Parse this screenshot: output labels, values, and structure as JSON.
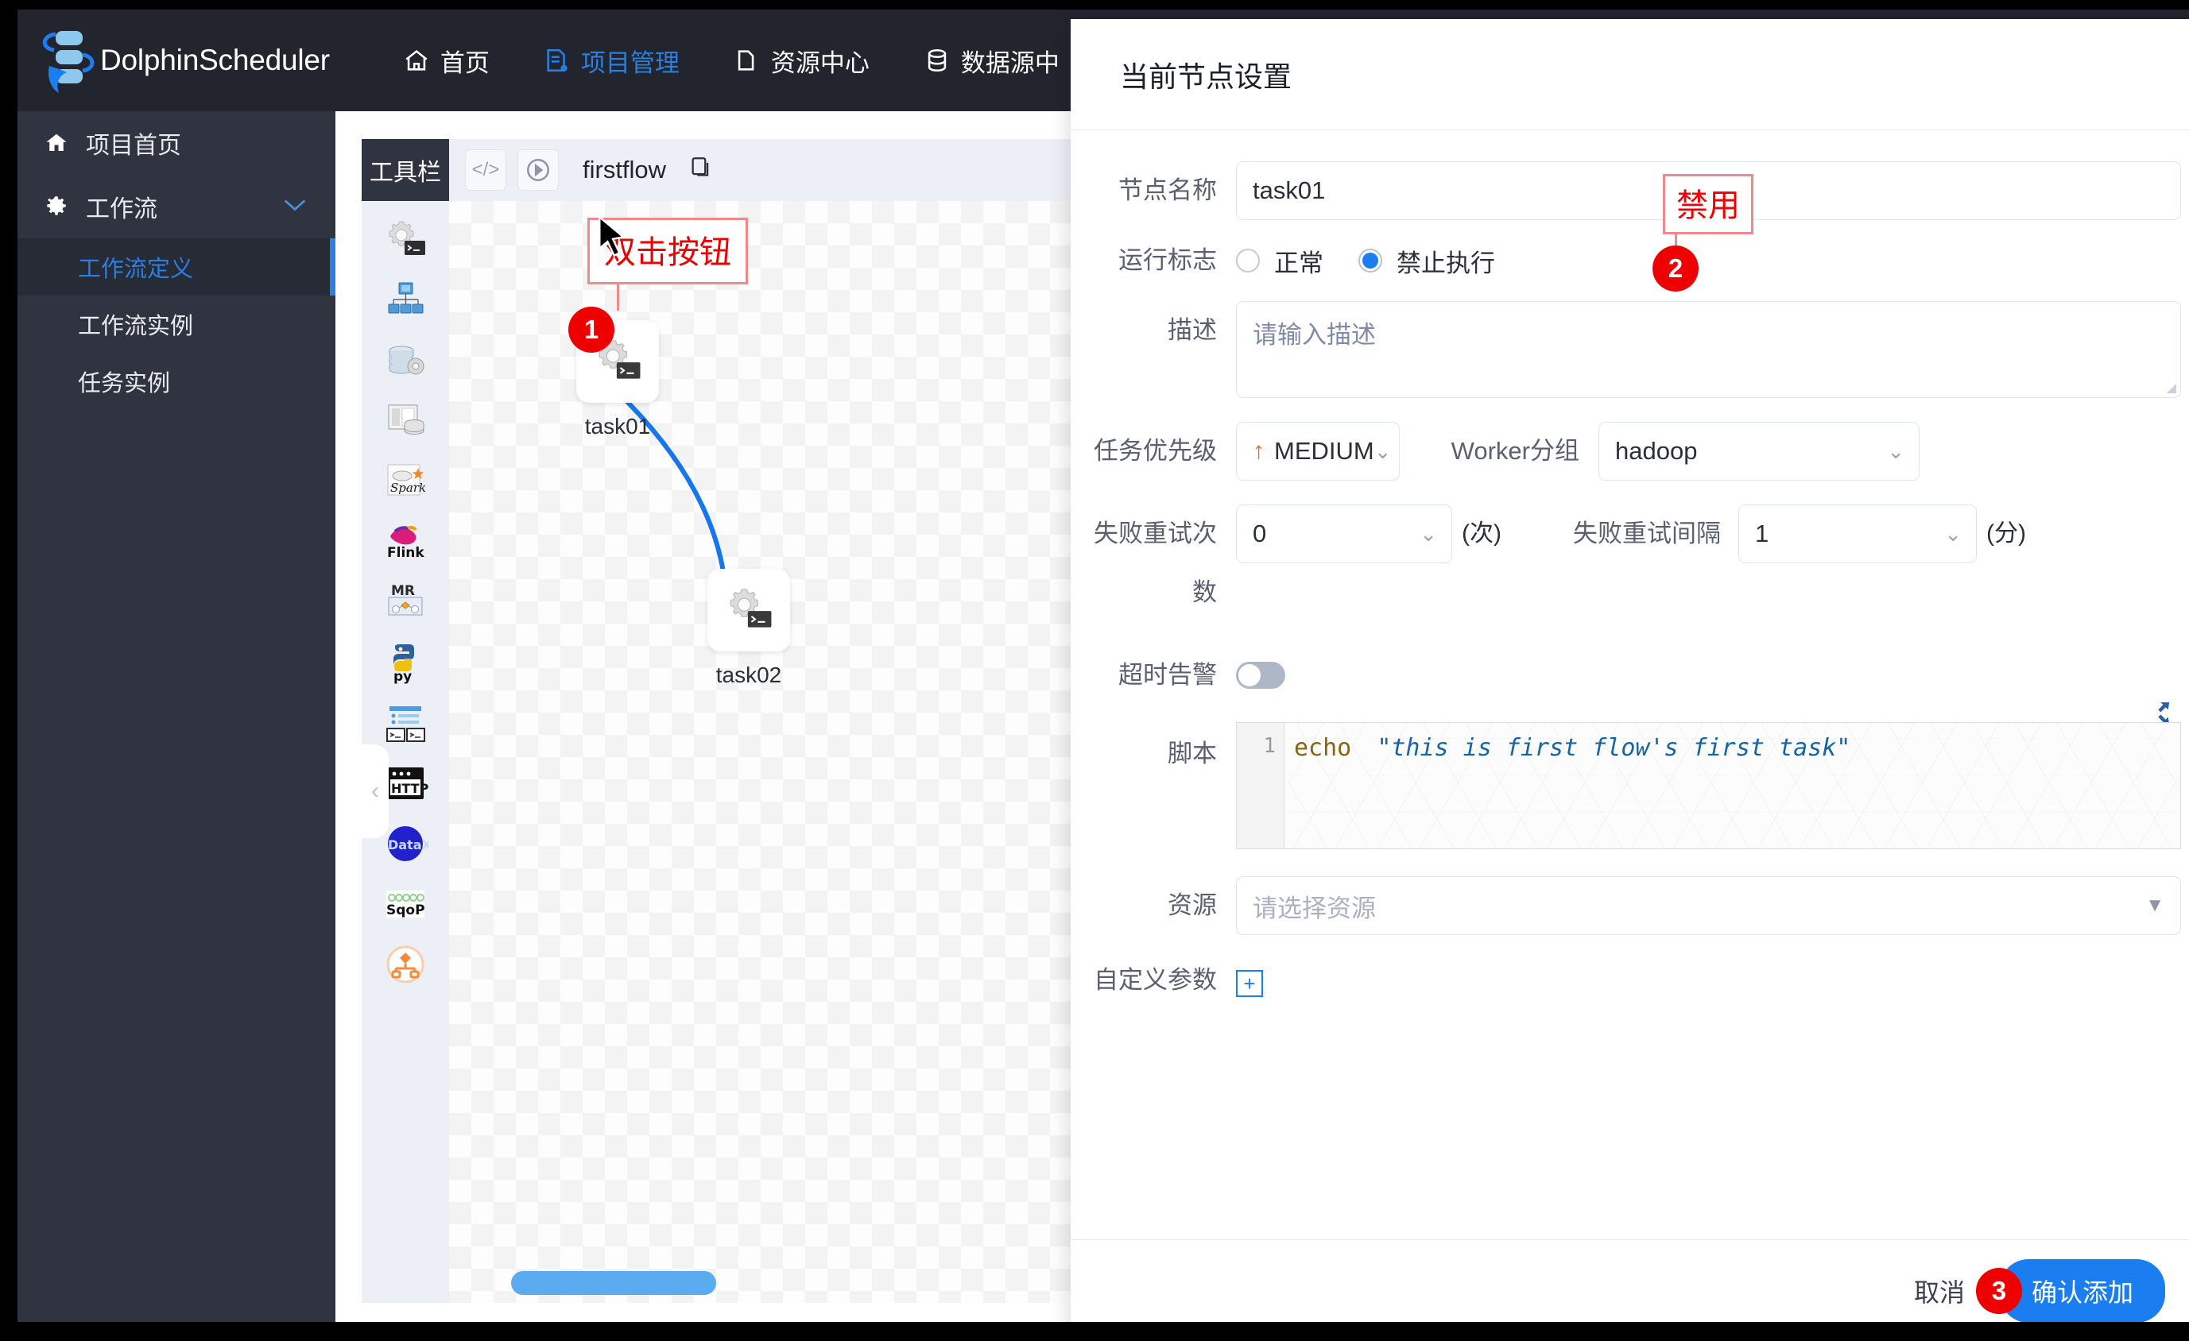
{
  "app": {
    "brand": "DolphinScheduler",
    "nav": [
      {
        "label": "首页",
        "icon": "home-icon",
        "active": false
      },
      {
        "label": "项目管理",
        "icon": "project-icon",
        "active": true
      },
      {
        "label": "资源中心",
        "icon": "folder-icon",
        "active": false
      },
      {
        "label": "数据源中",
        "icon": "database-icon",
        "active": false
      }
    ]
  },
  "sidebar": {
    "home": {
      "label": "项目首页",
      "icon": "home-icon"
    },
    "workflow": {
      "label": "工作流",
      "icon": "gear-icon",
      "chevron": "chevron-down-icon"
    },
    "sub": [
      {
        "label": "工作流定义",
        "active": true
      },
      {
        "label": "工作流实例",
        "active": false
      },
      {
        "label": "任务实例",
        "active": false
      }
    ]
  },
  "canvas": {
    "toolbar_title": "工具栏",
    "code_button": "</>",
    "play_button": "▶",
    "flow_name": "firstflow",
    "copy_icon": "copy-icon",
    "collapse_icon": "chevron-left-icon",
    "tools": [
      {
        "name": "shell-task-icon",
        "label": "SHELL"
      },
      {
        "name": "subprocess-task-icon",
        "label": "SUB_PROCESS"
      },
      {
        "name": "procedure-task-icon",
        "label": "PROCEDURE"
      },
      {
        "name": "sql-task-icon",
        "label": "SQL"
      },
      {
        "name": "spark-task-icon",
        "label": "SPARK"
      },
      {
        "name": "flink-task-icon",
        "label": "FLINK"
      },
      {
        "name": "mr-task-icon",
        "label": "MR"
      },
      {
        "name": "python-task-icon",
        "label": "PYTHON"
      },
      {
        "name": "dependent-task-icon",
        "label": "DEPENDENT"
      },
      {
        "name": "http-task-icon",
        "label": "HTTP"
      },
      {
        "name": "datax-task-icon",
        "label": "DATAX"
      },
      {
        "name": "sqoop-task-icon",
        "label": "SQOOP"
      },
      {
        "name": "conditions-task-icon",
        "label": "CONDITIONS"
      }
    ],
    "nodes": [
      {
        "id": "task01",
        "label": "task01",
        "icon": "shell-task-icon"
      },
      {
        "id": "task02",
        "label": "task02",
        "icon": "shell-task-icon"
      }
    ],
    "annotations": [
      {
        "step": "1",
        "text": "双击按钮"
      },
      {
        "step": "2",
        "text": "禁用"
      },
      {
        "step": "3",
        "text": ""
      }
    ]
  },
  "dialog": {
    "title": "当前节点设置",
    "fields": {
      "node_name_label": "节点名称",
      "node_name_value": "task01",
      "run_flag_label": "运行标志",
      "run_flag_options": [
        {
          "label": "正常",
          "selected": false
        },
        {
          "label": "禁止执行",
          "selected": true
        }
      ],
      "desc_label": "描述",
      "desc_placeholder": "请输入描述",
      "priority_label": "任务优先级",
      "priority_value": "MEDIUM",
      "worker_group_label": "Worker分组",
      "worker_group_value": "hadoop",
      "retry_times_label": "失败重试次数",
      "retry_times_value": "0",
      "retry_times_unit": "(次)",
      "retry_interval_label": "失败重试间隔",
      "retry_interval_value": "1",
      "retry_interval_unit": "(分)",
      "timeout_label": "超时告警",
      "script_label": "脚本",
      "script_line_no": "1",
      "script_keyword": "echo",
      "script_string": "\"this is first flow's first task\"",
      "resource_label": "资源",
      "resource_placeholder": "请选择资源",
      "custom_params_label": "自定义参数",
      "custom_params_add": "+"
    },
    "footer": {
      "cancel": "取消",
      "confirm": "确认添加",
      "confirm_step": "3"
    }
  }
}
